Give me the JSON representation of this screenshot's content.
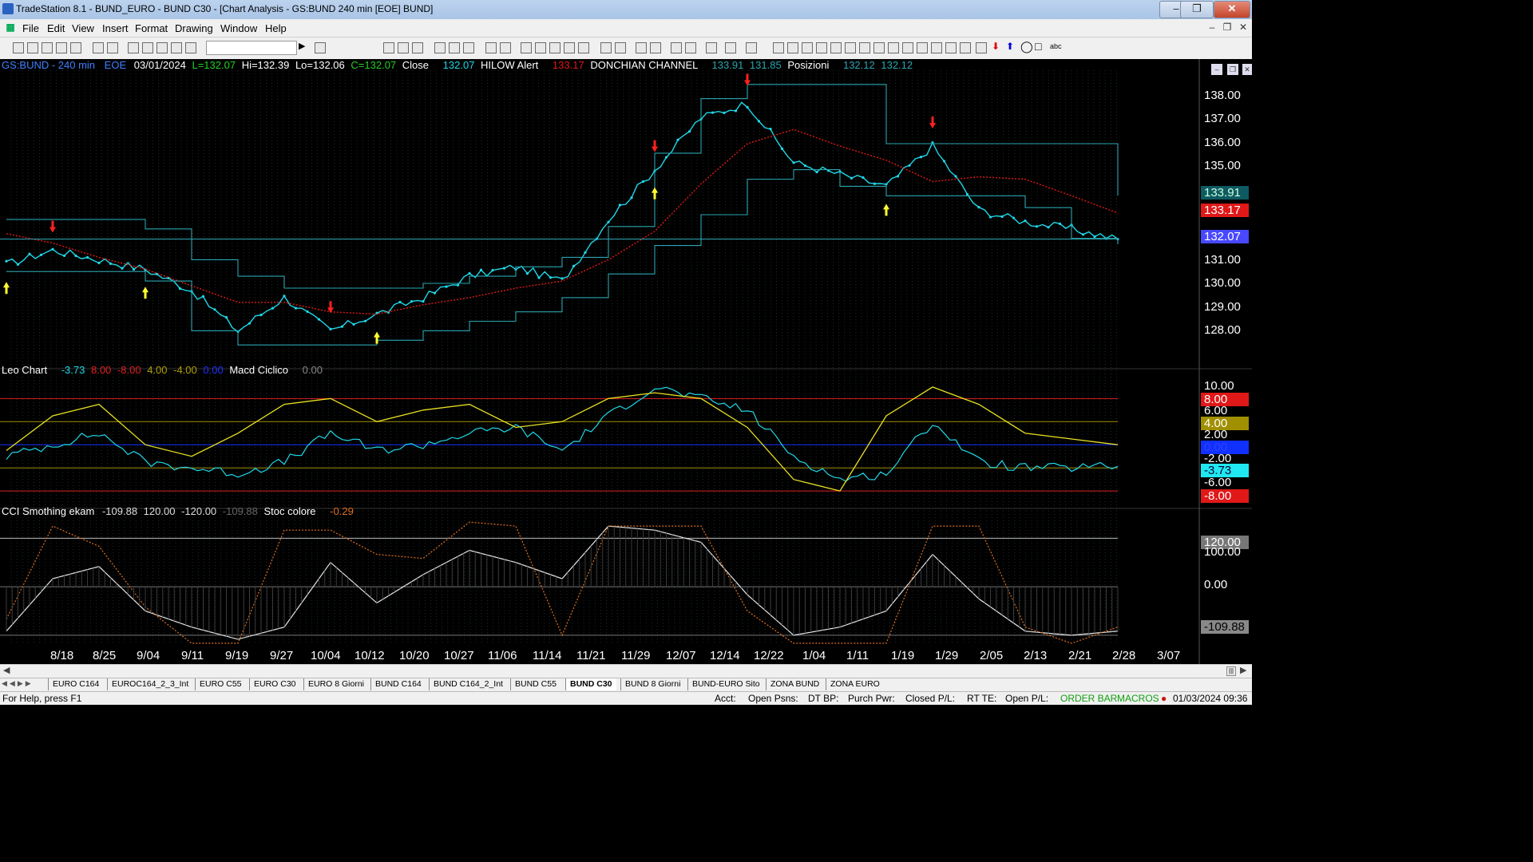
{
  "window": {
    "title": "TradeStation 8.1 - BUND_EURO - BUND  C30 - [Chart Analysis - GS:BUND  240 min  [EOE] BUND]"
  },
  "menu": [
    "File",
    "Edit",
    "View",
    "Insert",
    "Format",
    "Drawing",
    "Window",
    "Help"
  ],
  "price_header": {
    "symbol": "GS:BUND - 240 min",
    "session": "EOE",
    "date": "03/01/2024",
    "last": "L=132.07",
    "high": "Hi=132.39",
    "low": "Lo=132.06",
    "close_val": "C=132.07",
    "close_lbl": "Close",
    "close_num": "132.07",
    "hilow_lbl": "HILOW Alert",
    "hilow_num": "133.17",
    "donchian_lbl": "DONCHIAN CHANNEL",
    "donchian_a": "133.91",
    "donchian_b": "131.85",
    "pos_lbl": "Posizioni",
    "pos_a": "132.12",
    "pos_b": "132.12"
  },
  "osc_header": {
    "name": "Leo Chart",
    "v1": "-3.73",
    "v2": "8.00",
    "v3": "-8.00",
    "v4": "4.00",
    "v5": "-4.00",
    "v6": "0.00",
    "macd_lbl": "Macd Ciclico",
    "macd_val": "0.00"
  },
  "cci_header": {
    "name": "CCI Smothing ekam",
    "v1": "-109.88",
    "v2": "120.00",
    "v3": "-120.00",
    "v4": "-109.88",
    "stoc_lbl": "Stoc colore",
    "stoc_val": "-0.29"
  },
  "price_axis": [
    "138.00",
    "137.00",
    "136.00",
    "135.00",
    "133.91",
    "133.17",
    "132.07",
    "131.00",
    "130.00",
    "129.00",
    "128.00"
  ],
  "osc_axis": [
    "10.00",
    "8.00",
    "6.00",
    "4.00",
    "2.00",
    "0.00",
    "-2.00",
    "-3.73",
    "-6.00",
    "-8.00"
  ],
  "cci_axis": [
    "120.00",
    "100.00",
    "0.00",
    "-109.88"
  ],
  "dates": [
    "8/18",
    "8/25",
    "9/04",
    "9/11",
    "9/19",
    "9/27",
    "10/04",
    "10/12",
    "10/20",
    "10/27",
    "11/06",
    "11/14",
    "11/21",
    "11/29",
    "12/07",
    "12/14",
    "12/22",
    "1/04",
    "1/11",
    "1/19",
    "1/29",
    "2/05",
    "2/13",
    "2/21",
    "2/28",
    "3/07"
  ],
  "tabs": [
    "EURO C164",
    "EUROC164_2_3_Int",
    "EURO C55",
    "EURO C30",
    "EURO 8 Giorni",
    "BUND C164",
    "BUND C164_2_Int",
    "BUND C55",
    "BUND  C30",
    "BUND 8 Giorni",
    "BUND-EURO Sito",
    "ZONA BUND",
    "ZONA EURO"
  ],
  "status": {
    "help": "For Help, press F1",
    "acct": "Acct:",
    "open_psns": "Open Psns:",
    "dt_bp": "DT BP:",
    "purch_pwr": "Purch Pwr:",
    "closed_pl": "Closed P/L:",
    "rt_te": "RT TE:",
    "open_pl": "Open P/L:",
    "order_bar": "ORDER BAR",
    "macros": "MACROS",
    "datetime": "01/03/2024 09:36"
  },
  "colors": {
    "price": "#1fd8e8",
    "donchian": "#2aa5b0",
    "hilow": "#e01818",
    "ema": "#22d022",
    "yellow": "#e8e020",
    "red": "#e02020"
  },
  "chart_data": [
    {
      "type": "line",
      "title": "GS:BUND - 240 min",
      "x": [
        "8/18",
        "8/25",
        "9/04",
        "9/11",
        "9/19",
        "9/27",
        "10/04",
        "10/12",
        "10/20",
        "10/27",
        "11/06",
        "11/14",
        "11/21",
        "11/29",
        "12/07",
        "12/14",
        "12/22",
        "1/04",
        "1/11",
        "1/19",
        "1/29",
        "2/05",
        "2/13",
        "2/21",
        "2/28"
      ],
      "series": [
        {
          "name": "Close",
          "values": [
            131.0,
            131.6,
            131.2,
            130.8,
            129.9,
            128.2,
            129.6,
            128.2,
            128.9,
            129.6,
            130.5,
            130.9,
            130.3,
            132.9,
            135.0,
            137.2,
            137.8,
            135.3,
            134.8,
            134.3,
            136.0,
            133.3,
            132.8,
            132.5,
            132.07
          ]
        },
        {
          "name": "HILOW Alert",
          "values": [
            132.3,
            131.9,
            131.3,
            130.8,
            130.1,
            129.4,
            129.4,
            129.0,
            128.9,
            129.3,
            129.6,
            130.0,
            130.3,
            131.2,
            132.4,
            134.4,
            136.1,
            136.7,
            136.0,
            135.4,
            134.5,
            134.7,
            134.6,
            133.9,
            133.17
          ]
        },
        {
          "name": "DONCHIAN CHANNEL",
          "values": [
            132.9,
            132.9,
            132.9,
            132.5,
            131.2,
            130.5,
            130.0,
            130.0,
            130.0,
            130.2,
            130.5,
            130.9,
            131.3,
            132.6,
            135.7,
            138.0,
            138.6,
            138.6,
            138.6,
            136.1,
            136.1,
            136.1,
            136.1,
            136.1,
            133.91
          ]
        },
        {
          "name": "Posizioni",
          "values": [
            130.7,
            130.7,
            130.7,
            130.3,
            128.2,
            127.6,
            127.6,
            127.6,
            127.8,
            128.2,
            128.6,
            129.0,
            129.6,
            130.6,
            131.8,
            133.1,
            134.6,
            135.0,
            134.3,
            133.9,
            133.9,
            133.9,
            133.4,
            132.1,
            131.85
          ]
        }
      ],
      "ylim": [
        127.0,
        139.2
      ],
      "markers": {
        "up": [
          "8/18",
          "9/11",
          "10/20",
          "12/07",
          "1/19"
        ],
        "down": [
          "8/25",
          "10/12",
          "12/07",
          "12/22",
          "1/29"
        ]
      }
    },
    {
      "type": "line",
      "title": "Leo Chart",
      "x": [
        "8/18",
        "8/25",
        "9/04",
        "9/11",
        "9/19",
        "9/27",
        "10/04",
        "10/12",
        "10/20",
        "10/27",
        "11/06",
        "11/14",
        "11/21",
        "11/29",
        "12/07",
        "12/14",
        "12/22",
        "1/04",
        "1/11",
        "1/19",
        "1/29",
        "2/05",
        "2/13",
        "2/21",
        "2/28"
      ],
      "series": [
        {
          "name": "Leo Chart",
          "values": [
            -2.0,
            0.0,
            2.0,
            -3.0,
            -4.0,
            -5.0,
            -3.0,
            2.0,
            -1.0,
            0.0,
            2.0,
            3.0,
            -1.0,
            5.0,
            10.0,
            8.0,
            6.0,
            -2.0,
            -6.0,
            -5.0,
            4.0,
            -3.0,
            -4.0,
            -4.0,
            -3.73
          ]
        },
        {
          "name": "Macd Ciclico",
          "values": [
            -1.0,
            5.0,
            7.0,
            0.0,
            -2.0,
            2.0,
            7.0,
            8.0,
            4.0,
            6.0,
            7.0,
            3.0,
            4.0,
            8.0,
            9.0,
            8.0,
            3.0,
            -6.0,
            -8.0,
            5.0,
            10.0,
            7.0,
            2.0,
            1.0,
            0.0
          ]
        }
      ],
      "ylim": [
        -9.5,
        11.5
      ],
      "levels": [
        8.0,
        4.0,
        0.0,
        -4.0,
        -8.0
      ]
    },
    {
      "type": "line",
      "title": "CCI Smothing ekam",
      "x": [
        "8/18",
        "8/25",
        "9/04",
        "9/11",
        "9/19",
        "9/27",
        "10/04",
        "10/12",
        "10/20",
        "10/27",
        "11/06",
        "11/14",
        "11/21",
        "11/29",
        "12/07",
        "12/14",
        "12/22",
        "1/04",
        "1/11",
        "1/19",
        "1/29",
        "2/05",
        "2/13",
        "2/21",
        "2/28"
      ],
      "series": [
        {
          "name": "CCI Smothing ekam",
          "values": [
            -110,
            20,
            50,
            -60,
            -100,
            -130,
            -100,
            60,
            -40,
            30,
            90,
            60,
            20,
            150,
            140,
            110,
            -20,
            -120,
            -100,
            -60,
            80,
            -30,
            -110,
            -120,
            -109.88
          ]
        },
        {
          "name": "Stoc colore",
          "values": [
            -80,
            150,
            100,
            -50,
            -140,
            -140,
            140,
            140,
            80,
            70,
            160,
            150,
            -120,
            150,
            150,
            150,
            -60,
            -140,
            -140,
            -140,
            150,
            150,
            -100,
            -140,
            -100
          ]
        }
      ],
      "ylim": [
        -140,
        170
      ],
      "levels": [
        120,
        0,
        -120
      ]
    }
  ]
}
